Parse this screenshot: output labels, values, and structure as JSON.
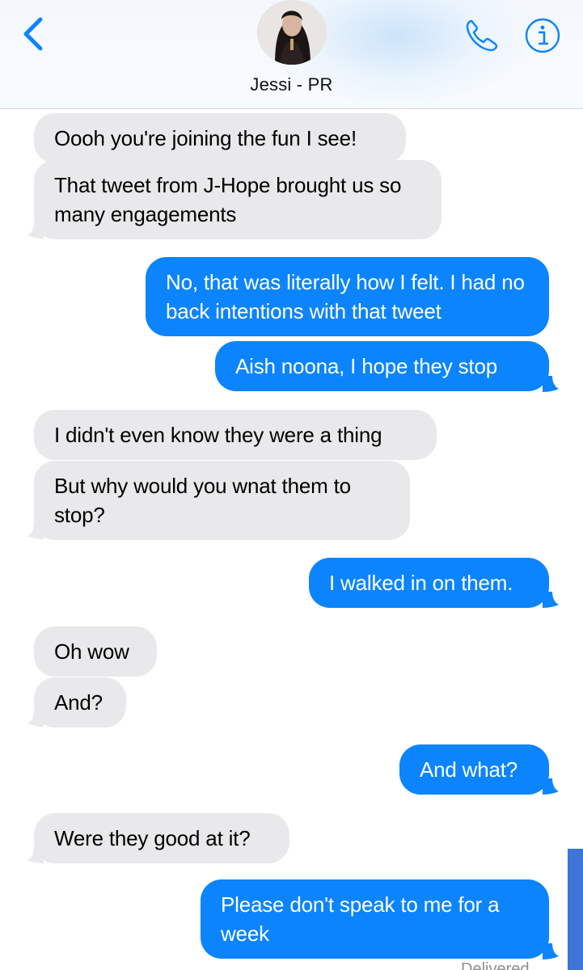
{
  "header": {
    "contact_name": "Jessi - PR"
  },
  "messages": [
    {
      "side": "in",
      "text": "Oooh you're joining the fun I see!"
    },
    {
      "side": "in",
      "text": "That tweet from J-Hope brought us so many engagements"
    },
    {
      "side": "out",
      "text": "No, that was literally how I felt. I had no back intentions with that tweet"
    },
    {
      "side": "out",
      "text": "Aish noona, I hope they stop"
    },
    {
      "side": "in",
      "text": "I didn't even know they were a thing"
    },
    {
      "side": "in",
      "text": "But why would you wnat them to stop?"
    },
    {
      "side": "out",
      "text": "I walked in on them."
    },
    {
      "side": "in",
      "text": "Oh wow"
    },
    {
      "side": "in",
      "text": "And?"
    },
    {
      "side": "out",
      "text": "And what?"
    },
    {
      "side": "in",
      "text": "Were they good at it?"
    },
    {
      "side": "out",
      "text": "Please don't speak to me for a week"
    }
  ],
  "status": {
    "delivered": "Delivered"
  },
  "colors": {
    "accent": "#0b84fe",
    "incoming_bubble": "#e9e9eb",
    "outgoing_bubble": "#0b84fe",
    "header_background": "#f6f9fd"
  },
  "icons": {
    "back": "chevron-left-icon",
    "call": "phone-icon",
    "info": "info-icon"
  }
}
